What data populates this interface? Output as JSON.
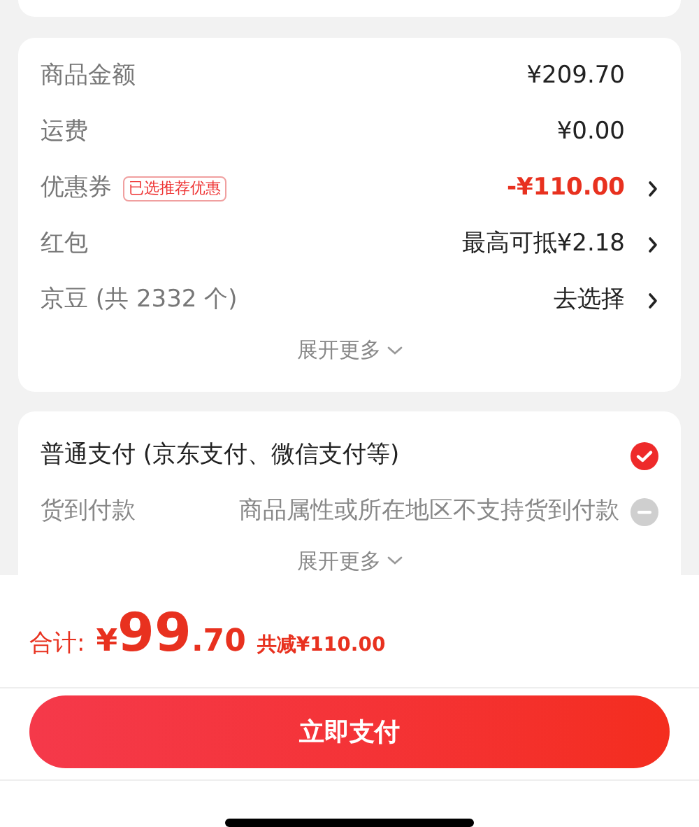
{
  "summary": {
    "rows": [
      {
        "label": "商品金额",
        "value": "¥209.70",
        "highlight": false,
        "arrow": false
      },
      {
        "label": "运费",
        "value": "¥0.00",
        "highlight": false,
        "arrow": false
      },
      {
        "label": "优惠券",
        "tag": "已选推荐优惠",
        "value": "-¥110.00",
        "highlight": true,
        "arrow": true
      },
      {
        "label": "红包",
        "value": "最高可抵¥2.18",
        "highlight": false,
        "arrow": true
      },
      {
        "label": "京豆 (共 2332 个)",
        "value": "去选择",
        "highlight": false,
        "arrow": true
      }
    ],
    "expand": "展开更多"
  },
  "payment": {
    "options": [
      {
        "label": "普通支付 (京东支付、微信支付等)",
        "selected": true,
        "disabled": false
      },
      {
        "label": "货到付款",
        "note": "商品属性或所在地区不支持货到付款",
        "selected": false,
        "disabled": true
      }
    ],
    "expand": "展开更多"
  },
  "footer": {
    "total_label": "合计:",
    "currency": "¥",
    "integer": "99",
    "decimal": ".70",
    "savings": "共减¥110.00",
    "pay_button": "立即支付"
  }
}
